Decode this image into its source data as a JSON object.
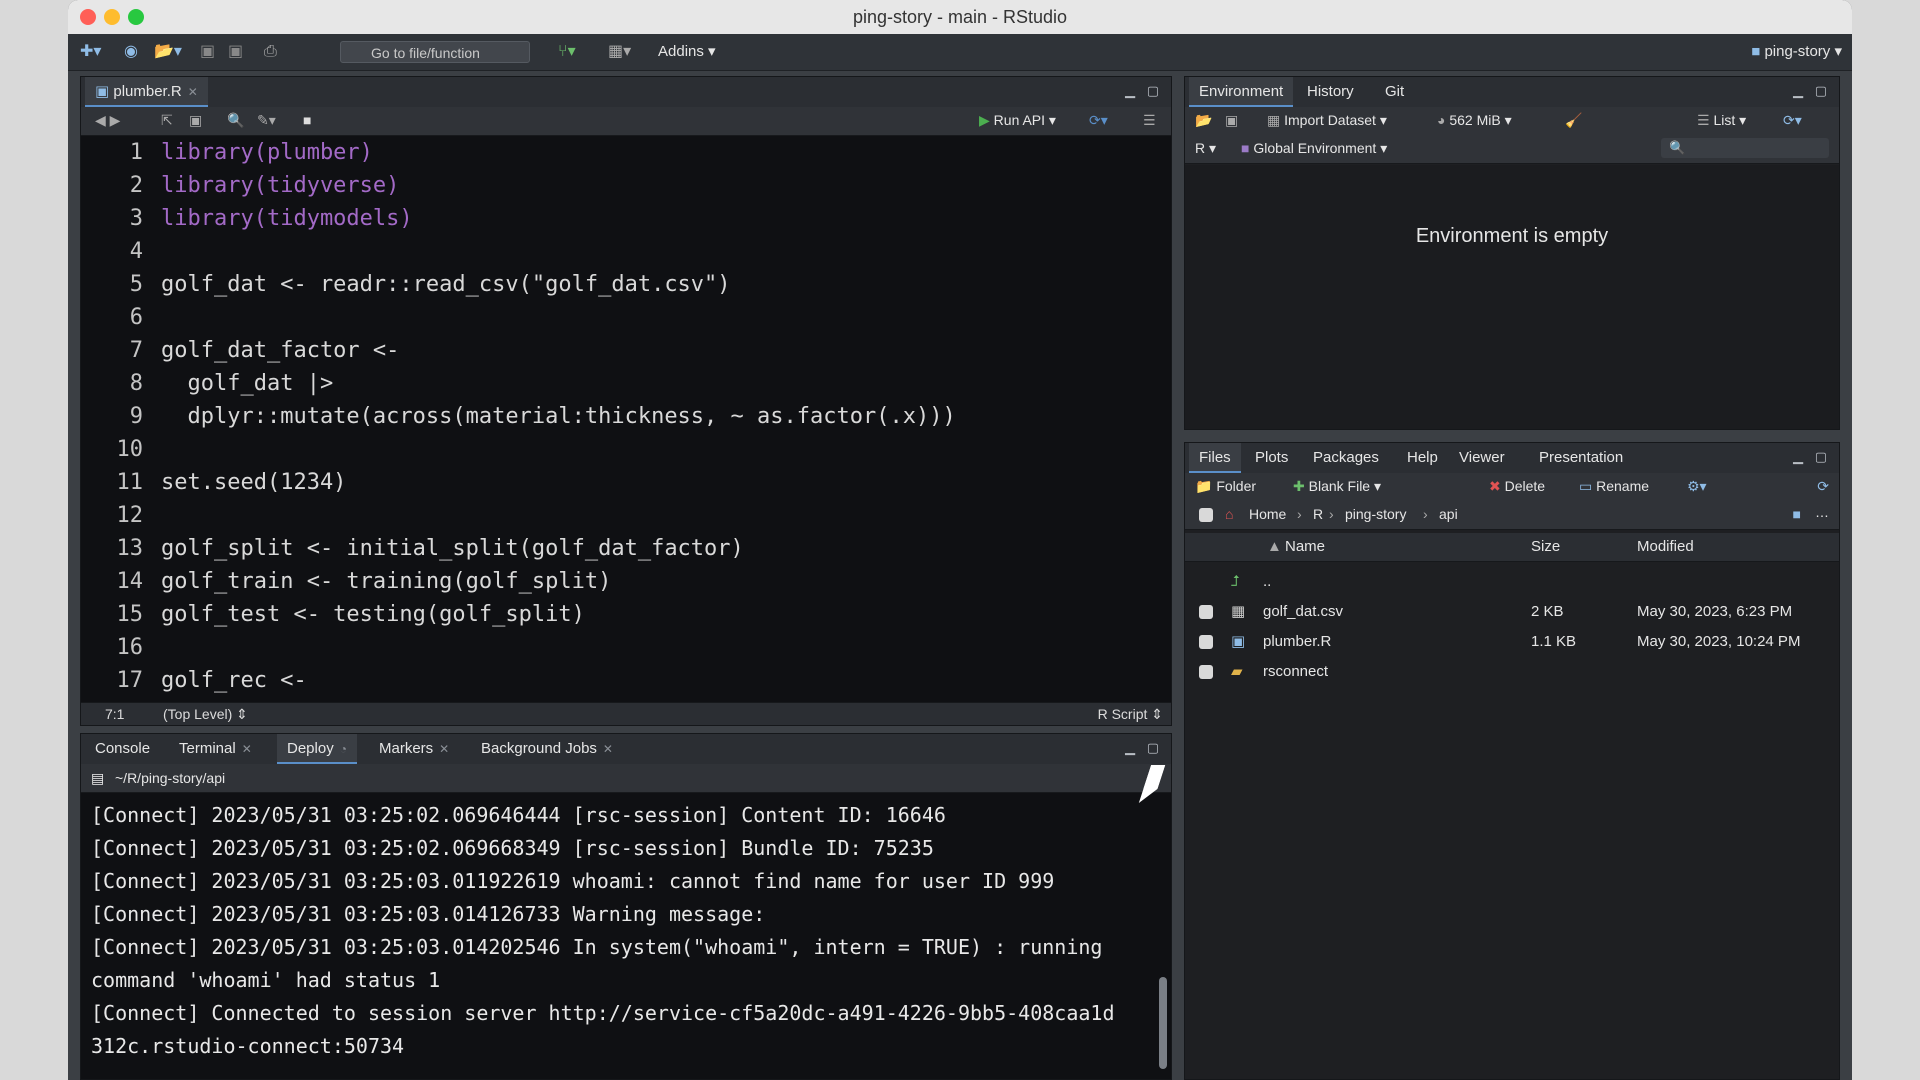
{
  "window": {
    "title": "ping-story - main - RStudio"
  },
  "toolbar": {
    "goto_placeholder": "Go to file/function",
    "addins_label": "Addins",
    "project_label": "ping-story"
  },
  "editor": {
    "tab_label": "plumber.R",
    "run_label": "Run API",
    "status_position": "7:1",
    "status_scope": "(Top Level)",
    "status_type": "R Script",
    "lines": [
      {
        "n": "1",
        "t": "library(plumber)"
      },
      {
        "n": "2",
        "t": "library(tidyverse)"
      },
      {
        "n": "3",
        "t": "library(tidymodels)"
      },
      {
        "n": "4",
        "t": ""
      },
      {
        "n": "5",
        "t": "golf_dat <- readr::read_csv(\"golf_dat.csv\")"
      },
      {
        "n": "6",
        "t": ""
      },
      {
        "n": "7",
        "t": "golf_dat_factor <-"
      },
      {
        "n": "8",
        "t": "  golf_dat |>"
      },
      {
        "n": "9",
        "t": "  dplyr::mutate(across(material:thickness, ~ as.factor(.x)))"
      },
      {
        "n": "10",
        "t": ""
      },
      {
        "n": "11",
        "t": "set.seed(1234)"
      },
      {
        "n": "12",
        "t": ""
      },
      {
        "n": "13",
        "t": "golf_split <- initial_split(golf_dat_factor)"
      },
      {
        "n": "14",
        "t": "golf_train <- training(golf_split)"
      },
      {
        "n": "15",
        "t": "golf_test <- testing(golf_split)"
      },
      {
        "n": "16",
        "t": ""
      },
      {
        "n": "17",
        "t": "golf_rec <-"
      }
    ]
  },
  "console": {
    "tabs": [
      "Console",
      "Terminal",
      "Deploy",
      "Markers",
      "Background Jobs"
    ],
    "path": "~/R/ping-story/api",
    "lines": [
      "[Connect] 2023/05/31 03:25:02.069646444 [rsc-session] Content ID: 16646",
      "[Connect] 2023/05/31 03:25:02.069668349 [rsc-session] Bundle ID: 75235",
      "[Connect] 2023/05/31 03:25:03.011922619 whoami: cannot find name for user ID 999",
      "[Connect] 2023/05/31 03:25:03.014126733 Warning message:",
      "[Connect] 2023/05/31 03:25:03.014202546 In system(\"whoami\", intern = TRUE) : running",
      "command 'whoami' had status 1",
      "[Connect] Connected to session server http://service-cf5a20dc-a491-4226-9bb5-408caa1d",
      "312c.rstudio-connect:50734"
    ]
  },
  "environment": {
    "tabs": [
      "Environment",
      "History",
      "Git"
    ],
    "import_label": "Import Dataset",
    "memory_label": "562 MiB",
    "list_label": "List",
    "lang_label": "R",
    "scope_label": "Global Environment",
    "empty_message": "Environment is empty"
  },
  "files": {
    "tabs": [
      "Files",
      "Plots",
      "Packages",
      "Help",
      "Viewer",
      "Presentation"
    ],
    "actions": {
      "folder": "Folder",
      "blank": "Blank File",
      "delete": "Delete",
      "rename": "Rename"
    },
    "breadcrumb": [
      "Home",
      "R",
      "ping-story",
      "api"
    ],
    "columns": {
      "name": "Name",
      "size": "Size",
      "modified": "Modified"
    },
    "up_label": "..",
    "rows": [
      {
        "name": "golf_dat.csv",
        "size": "2 KB",
        "modified": "May 30, 2023, 6:23 PM"
      },
      {
        "name": "plumber.R",
        "size": "1.1 KB",
        "modified": "May 30, 2023, 10:24 PM"
      },
      {
        "name": "rsconnect",
        "size": "",
        "modified": ""
      }
    ]
  }
}
